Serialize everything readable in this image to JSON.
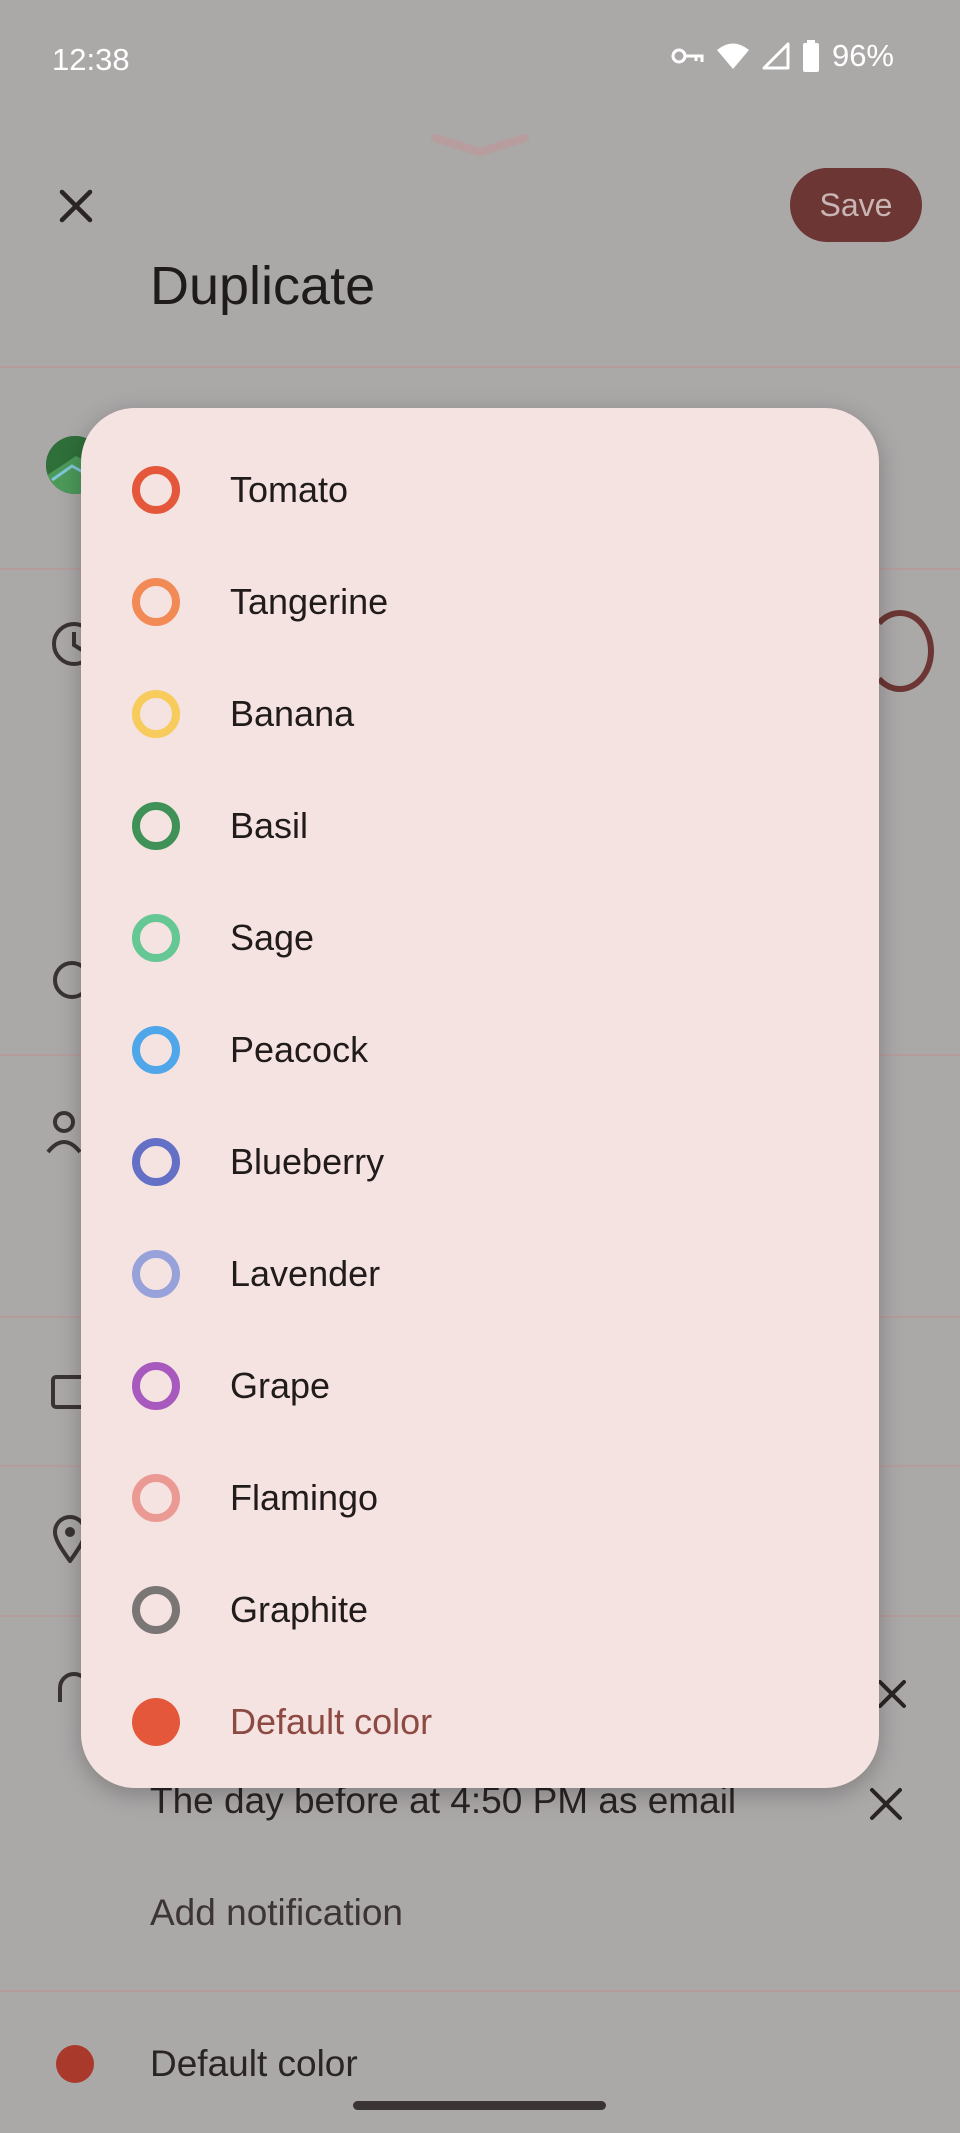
{
  "status_bar": {
    "time": "12:38",
    "battery": "96%",
    "icons": [
      "vpn-key-icon",
      "wifi-icon",
      "signal-icon",
      "battery-icon"
    ]
  },
  "header": {
    "close_icon": "close-icon",
    "save_label": "Save",
    "title": "Duplicate"
  },
  "notifications": {
    "second": "The day before at 4:50 PM as email",
    "add_label": "Add notification"
  },
  "color_row": {
    "label": "Default color",
    "color": "#a8392b"
  },
  "color_menu": {
    "items": [
      {
        "label": "Tomato",
        "color": "#e4573a",
        "selected": false
      },
      {
        "label": "Tangerine",
        "color": "#f28a55",
        "selected": false
      },
      {
        "label": "Banana",
        "color": "#f7cb5c",
        "selected": false
      },
      {
        "label": "Basil",
        "color": "#3f9158",
        "selected": false
      },
      {
        "label": "Sage",
        "color": "#65c793",
        "selected": false
      },
      {
        "label": "Peacock",
        "color": "#4fa6e9",
        "selected": false
      },
      {
        "label": "Blueberry",
        "color": "#6470c5",
        "selected": false
      },
      {
        "label": "Lavender",
        "color": "#98a2da",
        "selected": false
      },
      {
        "label": "Grape",
        "color": "#a859bd",
        "selected": false
      },
      {
        "label": "Flamingo",
        "color": "#eb9a93",
        "selected": false
      },
      {
        "label": "Graphite",
        "color": "#7a7676",
        "selected": false
      },
      {
        "label": "Default color",
        "color": "#e4573a",
        "selected": true
      }
    ]
  }
}
